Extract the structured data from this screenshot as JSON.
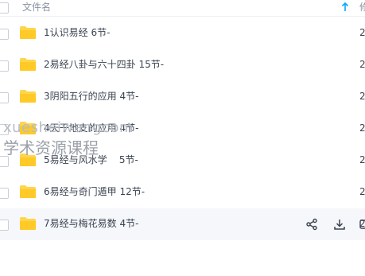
{
  "header": {
    "title": "文件名",
    "extra": "修"
  },
  "rows": [
    {
      "name": "1认识易经 6节-",
      "date": "2"
    },
    {
      "name": "2易经八卦与六十四卦 15节-",
      "date": "2"
    },
    {
      "name": "3阴阳五行的应用 4节-",
      "date": "2"
    },
    {
      "name": "4天干地支的应用 4节-",
      "date": "2"
    },
    {
      "name": "5易经与风水学    5节-",
      "date": "2"
    },
    {
      "name": "6易经与奇门遁甲 12节-",
      "date": "2"
    },
    {
      "name": "7易经与梅花易数 4节-",
      "date": "2"
    }
  ],
  "watermark": {
    "line1": "xuesheiwangcom",
    "line2": "学术资源课程"
  },
  "colors": {
    "folder": "#ffd54a",
    "accent": "#06a7ff",
    "hover": "#f5f7fb"
  },
  "icons": {
    "sort": "arrow-up-icon",
    "share": "share-icon",
    "download": "download-icon",
    "more": "more-icon"
  }
}
